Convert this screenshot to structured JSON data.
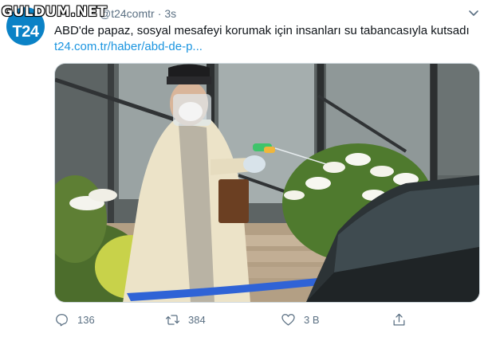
{
  "watermark": "GULDUM.NET",
  "account": {
    "avatar_text": "T24",
    "handle": "@t24comtr",
    "separator": "·",
    "time": "3s"
  },
  "tweet": {
    "text": "ABD'de papaz, sosyal mesafeyi korumak için insanları su tabancasıyla kutsadı",
    "link": "t24.com.tr/haber/abd-de-p..."
  },
  "actions": {
    "reply_count": "136",
    "retweet_count": "384",
    "like_count": "3 B"
  },
  "icons": {
    "more": "chevron-down-icon",
    "reply": "reply-icon",
    "retweet": "retweet-icon",
    "like": "heart-icon",
    "share": "share-icon"
  },
  "colors": {
    "brand": "#0b82c6",
    "link": "#1b95e0",
    "muted": "#5b7083"
  }
}
